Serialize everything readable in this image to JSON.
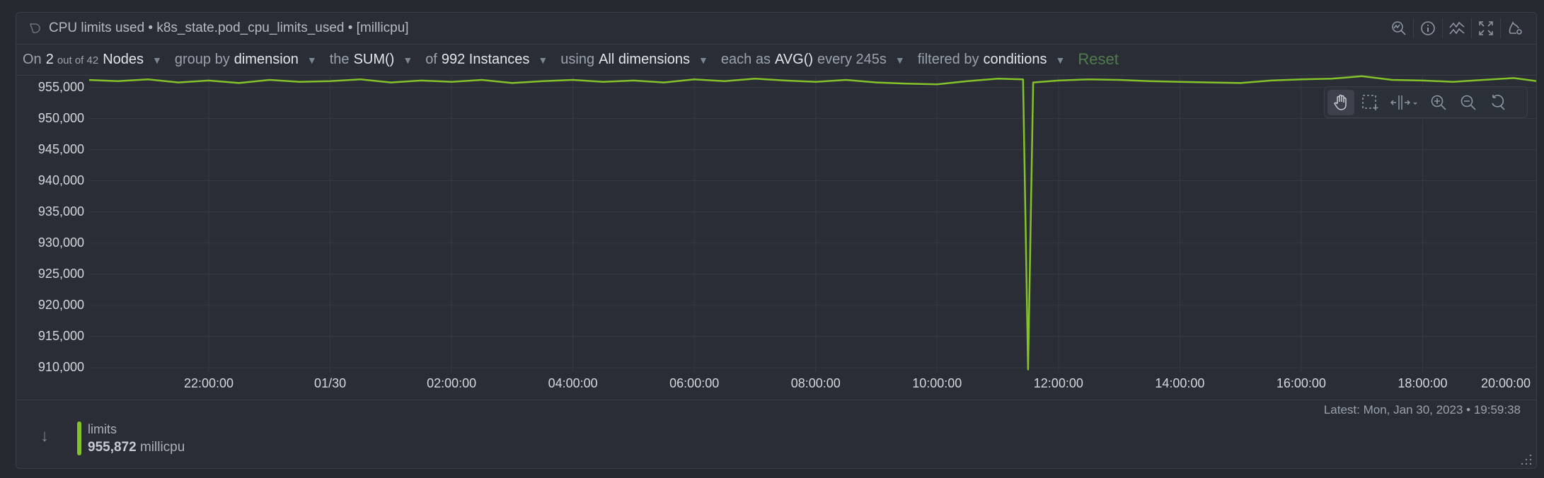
{
  "header": {
    "title": "CPU limits used • k8s_state.pod_cpu_limits_used • [millicpu]",
    "tools": [
      "search-chart-icon",
      "info-icon",
      "correlations-icon",
      "fullscreen-icon",
      "alert-icon"
    ]
  },
  "filters": [
    {
      "prefix": "On",
      "value": "2",
      "small": "out of 42",
      "suffix": "Nodes"
    },
    {
      "prefix": "group by",
      "value": "dimension"
    },
    {
      "prefix": "the",
      "value": "SUM()"
    },
    {
      "prefix": "of",
      "value": "992 Instances"
    },
    {
      "prefix": "using",
      "value": "All dimensions"
    },
    {
      "prefix": "each as",
      "value": "AVG()",
      "suffix": "every 245s"
    },
    {
      "prefix": "filtered by",
      "value": "conditions"
    }
  ],
  "reset_label": "Reset",
  "chart_toolbar": [
    "pan-icon",
    "select-icon",
    "highlight-icon",
    "zoom-in-icon",
    "zoom-out-icon",
    "reset-zoom-icon"
  ],
  "colors": {
    "series": "#84c22a",
    "reset": "#4f7c4c"
  },
  "chart_data": {
    "type": "line",
    "ylim": [
      909300,
      957000
    ],
    "xlim": [
      "01/29 20:00",
      "01/30 20:00"
    ],
    "y_ticks": [
      "955,000",
      "950,000",
      "945,000",
      "940,000",
      "935,000",
      "930,000",
      "925,000",
      "920,000",
      "915,000",
      "910,000"
    ],
    "y_tick_values": [
      955000,
      950000,
      945000,
      940000,
      935000,
      930000,
      925000,
      920000,
      915000,
      910000
    ],
    "x_ticks": [
      "22:00:00",
      "01/30",
      "02:00:00",
      "04:00:00",
      "06:00:00",
      "08:00:00",
      "10:00:00",
      "12:00:00",
      "14:00:00",
      "16:00:00",
      "18:00:00",
      "20:00:00"
    ],
    "x_tick_times": [
      "01/29 22:00",
      "01/30 00:00",
      "01/30 02:00",
      "01/30 04:00",
      "01/30 06:00",
      "01/30 08:00",
      "01/30 10:00",
      "01/30 12:00",
      "01/30 14:00",
      "01/30 16:00",
      "01/30 18:00",
      "01/30 20:00"
    ],
    "grid": true,
    "series": [
      {
        "name": "limits",
        "x": [
          "01/29 20:00",
          "01/29 20:30",
          "01/29 21:00",
          "01/29 21:30",
          "01/29 22:00",
          "01/29 22:30",
          "01/29 23:00",
          "01/29 23:30",
          "01/30 00:00",
          "01/30 00:30",
          "01/30 01:00",
          "01/30 01:30",
          "01/30 02:00",
          "01/30 02:30",
          "01/30 03:00",
          "01/30 03:30",
          "01/30 04:00",
          "01/30 04:30",
          "01/30 05:00",
          "01/30 05:30",
          "01/30 06:00",
          "01/30 06:30",
          "01/30 07:00",
          "01/30 07:30",
          "01/30 08:00",
          "01/30 08:30",
          "01/30 09:00",
          "01/30 09:30",
          "01/30 10:00",
          "01/30 10:30",
          "01/30 11:00",
          "01/30 11:25",
          "01/30 11:30",
          "01/30 11:35",
          "01/30 12:00",
          "01/30 12:30",
          "01/30 13:00",
          "01/30 13:30",
          "01/30 14:00",
          "01/30 14:30",
          "01/30 15:00",
          "01/30 15:30",
          "01/30 16:00",
          "01/30 16:30",
          "01/30 17:00",
          "01/30 17:30",
          "01/30 18:00",
          "01/30 18:30",
          "01/30 19:00",
          "01/30 19:30",
          "01/30 19:59"
        ],
        "values": [
          956200,
          956000,
          956300,
          955800,
          956100,
          955700,
          956200,
          955900,
          956000,
          956300,
          955800,
          956100,
          955900,
          956200,
          955700,
          956000,
          956200,
          955900,
          956100,
          955800,
          956300,
          956000,
          956400,
          956100,
          955900,
          956200,
          955800,
          955600,
          955500,
          956000,
          956400,
          956300,
          909700,
          955800,
          956100,
          956300,
          956200,
          956000,
          955900,
          955800,
          955700,
          956100,
          956300,
          956400,
          956800,
          956200,
          956100,
          955900,
          956200,
          956500,
          955872
        ]
      }
    ]
  },
  "footer": {
    "latest": "Latest:  Mon, Jan 30, 2023 • 19:59:38",
    "legend_name": "limits",
    "legend_value": "955,872",
    "legend_unit": "millicpu"
  }
}
